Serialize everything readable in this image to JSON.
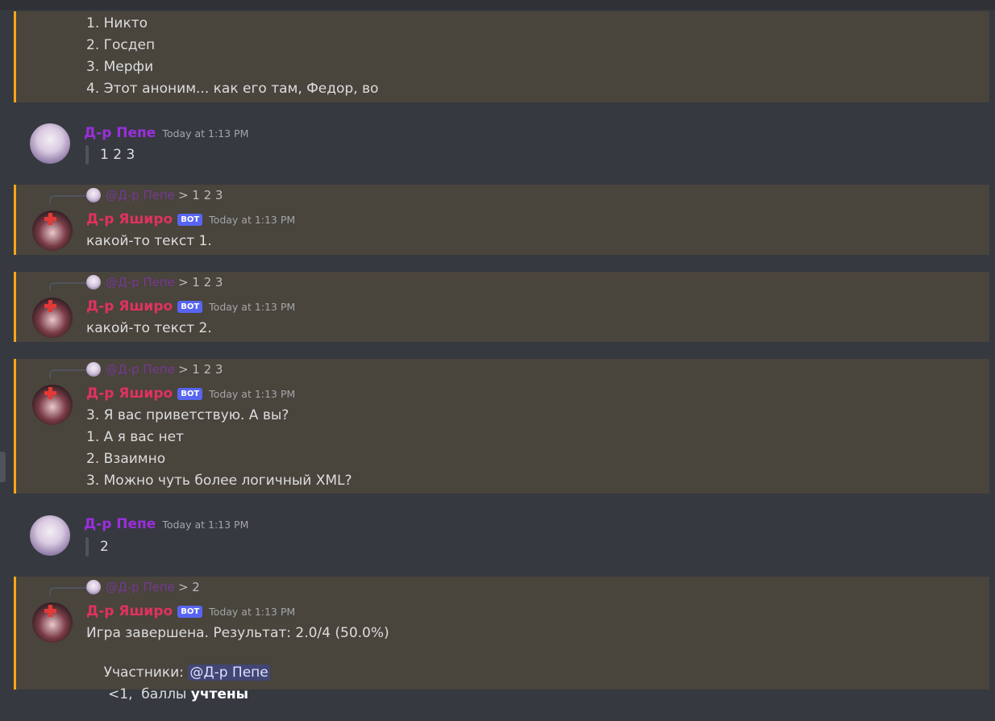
{
  "accent": {
    "mention_bg": "#49443c",
    "mention_border": "#faa61a",
    "pepe_color": "#9b2fdc",
    "bot_color": "#e0325f",
    "badge_color": "#5865f2"
  },
  "messages": {
    "m0": {
      "lines": [
        "1. Никто",
        "2. Госдеп",
        "3. Мерфи",
        "4. Этот аноним... как его там, Федор, во"
      ]
    },
    "m1": {
      "author": "Д-р Пепе",
      "time": "Today at 1:13 PM",
      "quote": "1 2 3"
    },
    "m2": {
      "reply_name": "@Д-р Пепе",
      "reply_text": "> 1 2 3",
      "author": "Д-р Яширо",
      "badge": "BOT",
      "time": "Today at 1:13 PM",
      "lines": [
        "какой-то текст 1."
      ]
    },
    "m3": {
      "reply_name": "@Д-р Пепе",
      "reply_text": "> 1 2 3",
      "author": "Д-р Яширо",
      "badge": "BOT",
      "time": "Today at 1:13 PM",
      "lines": [
        "какой-то текст 2."
      ]
    },
    "m4": {
      "reply_name": "@Д-р Пепе",
      "reply_text": "> 1 2 3",
      "author": "Д-р Яширо",
      "badge": "BOT",
      "time": "Today at 1:13 PM",
      "lines": [
        "3. Я вас приветствую. А вы?",
        "1. А я вас нет",
        "2. Взаимно",
        "3. Можно чуть более логичный XML?"
      ]
    },
    "m5": {
      "author": "Д-р Пепе",
      "time": "Today at 1:13 PM",
      "quote": "2"
    },
    "m6": {
      "reply_name": "@Д-р Пепе",
      "reply_text": "> 2",
      "author": "Д-р Яширо",
      "badge": "BOT",
      "time": "Today at 1:13 PM",
      "line1": "Игра завершена. Результат: 2.0/4 (50.0%)",
      "line2_prefix": "Участники: ",
      "line2_mention": "@Д-р Пепе",
      "line3_prefix": " <1,  баллы ",
      "line3_bold": "учтены"
    }
  }
}
